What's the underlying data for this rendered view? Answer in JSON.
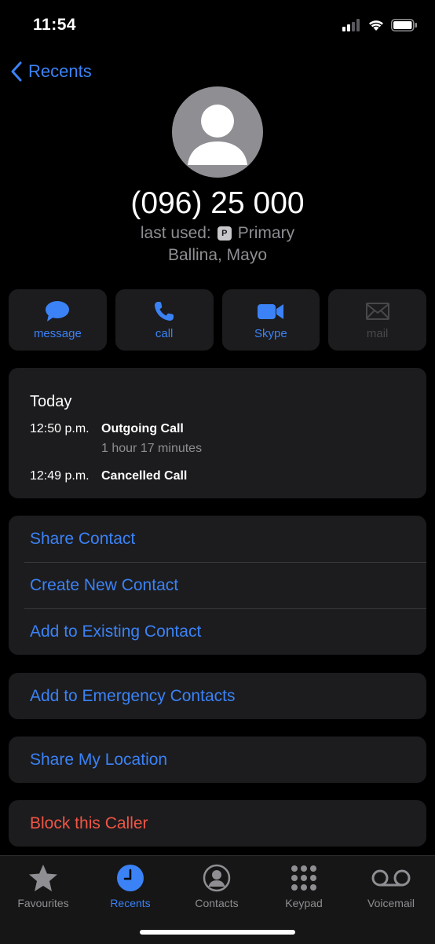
{
  "status_bar": {
    "time": "11:54"
  },
  "nav": {
    "back_label": "Recents"
  },
  "contact": {
    "phone_number": "(096) 25 000",
    "last_used_label": "last used:",
    "line_badge": "P",
    "line_name": "Primary",
    "location": "Ballina, Mayo"
  },
  "actions": [
    {
      "label": "message",
      "icon": "message-bubble-icon",
      "enabled": true
    },
    {
      "label": "call",
      "icon": "phone-icon",
      "enabled": true
    },
    {
      "label": "Skype",
      "icon": "video-camera-icon",
      "enabled": true
    },
    {
      "label": "mail",
      "icon": "envelope-icon",
      "enabled": false
    }
  ],
  "history": {
    "header": "Today",
    "calls": [
      {
        "time": "12:50 p.m.",
        "type": "Outgoing Call",
        "duration": "1 hour 17 minutes"
      },
      {
        "time": "12:49 p.m.",
        "type": "Cancelled Call",
        "duration": ""
      }
    ]
  },
  "options": {
    "share_contact": "Share Contact",
    "create_new_contact": "Create New Contact",
    "add_to_existing": "Add to Existing Contact",
    "add_to_emergency": "Add to Emergency Contacts",
    "share_location": "Share My Location",
    "block_caller": "Block this Caller"
  },
  "tabs": [
    {
      "label": "Favourites",
      "icon": "star-icon",
      "active": false
    },
    {
      "label": "Recents",
      "icon": "clock-icon",
      "active": true
    },
    {
      "label": "Contacts",
      "icon": "person-circle-icon",
      "active": false
    },
    {
      "label": "Keypad",
      "icon": "keypad-icon",
      "active": false
    },
    {
      "label": "Voicemail",
      "icon": "voicemail-icon",
      "active": false
    }
  ],
  "colors": {
    "accent": "#3b82f6",
    "destructive": "#f05545",
    "card_background": "#1c1c1e",
    "secondary_text": "#8e8e93"
  }
}
